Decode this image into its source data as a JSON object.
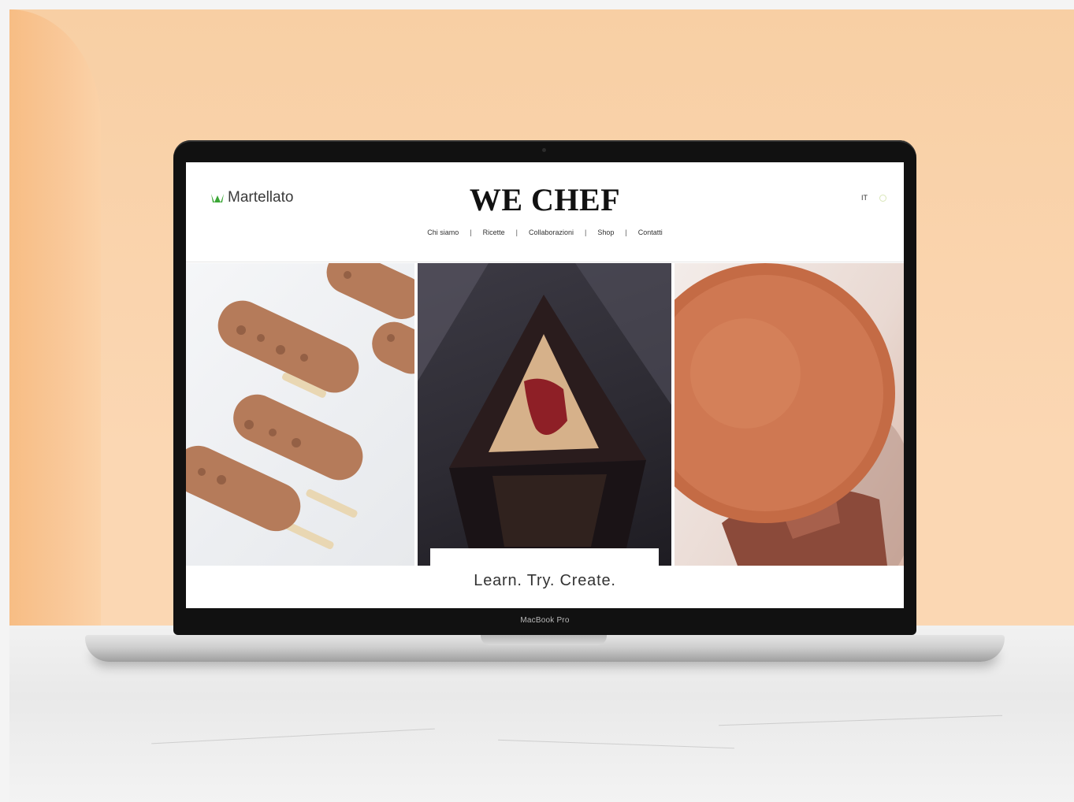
{
  "site": {
    "brand_name": "Martellato",
    "title": "WE CHEF",
    "nav": [
      "Chi siamo",
      "Ricette",
      "Collaborazioni",
      "Shop",
      "Contatti"
    ],
    "lang": "IT",
    "tagline": "Learn. Try. Create."
  },
  "device": {
    "label": "MacBook Pro"
  },
  "colors": {
    "background_peach": "#f8cfa4",
    "brand_leaf": "#3aa635",
    "title_text": "#111111"
  },
  "icons": {
    "brand_logo": "crown-leaf-icon",
    "search": "search-icon"
  }
}
